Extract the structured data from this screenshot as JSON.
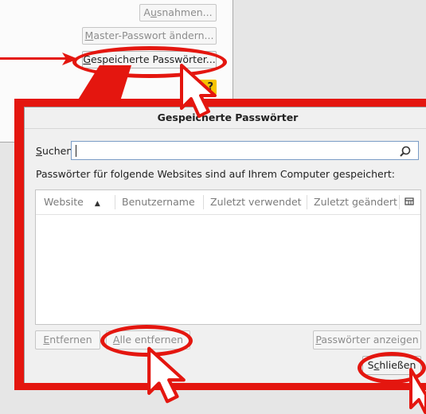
{
  "background_panel": {
    "buttons": [
      {
        "id": "exceptions",
        "pre": "A",
        "acc": "u",
        "post": "snahmen..."
      },
      {
        "id": "master",
        "pre": "",
        "acc": "M",
        "post": "aster-Passwort ändern..."
      },
      {
        "id": "saved",
        "pre": "",
        "acc": "G",
        "post": "espeicherte Passwörter..."
      }
    ],
    "help_glyph": "?"
  },
  "dialog": {
    "title": "Gespeicherte Passwörter",
    "search_label_acc": "S",
    "search_label_rest": "uchen:",
    "search_value": "",
    "info_text": "Passwörter für folgende Websites sind auf Ihrem Computer gespeichert:",
    "columns": [
      {
        "label": "Website",
        "sort": "▲"
      },
      {
        "label": "Benutzername"
      },
      {
        "label": "Zuletzt verwendet"
      },
      {
        "label": "Zuletzt geändert"
      }
    ],
    "rows": [],
    "buttons": {
      "remove": {
        "acc": "E",
        "rest": "ntfernen"
      },
      "remove_all": {
        "acc": "A",
        "rest": "lle entfernen"
      },
      "show_passwords": {
        "acc": "P",
        "rest": "asswörter anzeigen"
      },
      "close": {
        "pre": "S",
        "acc": "c",
        "rest": "hließen"
      }
    }
  },
  "annotation_color": "#e4160f",
  "icons": [
    "search-icon",
    "column-picker-icon",
    "cursor-icon",
    "arrow-icon"
  ]
}
